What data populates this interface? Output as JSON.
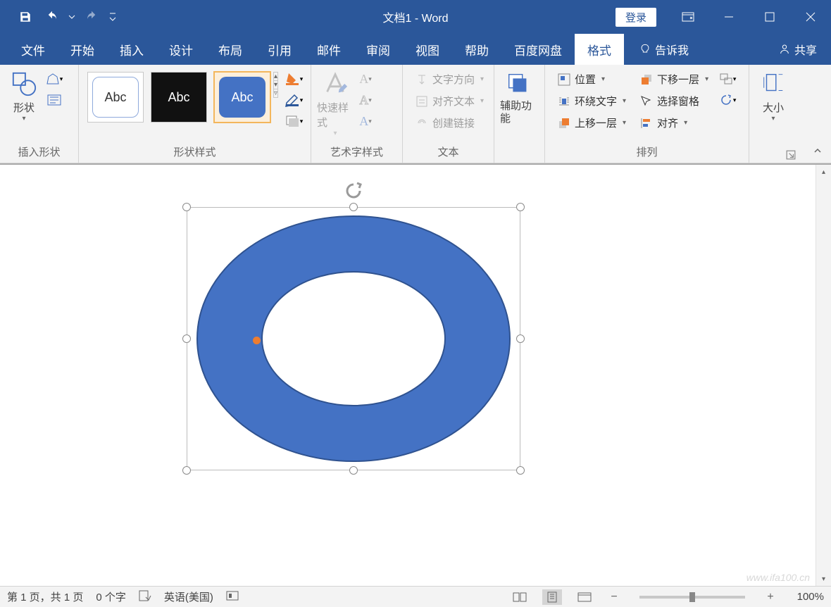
{
  "title_bar": {
    "doc_title": "文档1  -  Word",
    "login": "登录"
  },
  "tabs": {
    "items": [
      "文件",
      "开始",
      "插入",
      "设计",
      "布局",
      "引用",
      "邮件",
      "审阅",
      "视图",
      "帮助",
      "百度网盘",
      "格式"
    ],
    "active_index": 11,
    "tell_me": "告诉我",
    "share": "共享"
  },
  "ribbon": {
    "insert_shapes": {
      "big": "形状",
      "label": "插入形状"
    },
    "shape_styles": {
      "thumb_text": "Abc",
      "label": "形状样式"
    },
    "wordart": {
      "big": "快速样式",
      "label": "艺术字样式"
    },
    "text_group": {
      "cmd1": "文字方向",
      "cmd2": "对齐文本",
      "cmd3": "创建链接",
      "label": "文本"
    },
    "accessibility": {
      "big": "辅助功能",
      "label": ""
    },
    "arrange": {
      "position": "位置",
      "wrap": "环绕文字",
      "forward": "上移一层",
      "backward": "下移一层",
      "selection": "选择窗格",
      "align": "对齐",
      "label": "排列"
    },
    "size": {
      "big": "大小",
      "label": ""
    }
  },
  "status": {
    "page": "第 1 页，共 1 页",
    "words": "0 个字",
    "lang": "英语(美国)",
    "zoom": "100%"
  },
  "shape": {
    "fill": "#4472c4",
    "stroke": "#2f528f"
  }
}
